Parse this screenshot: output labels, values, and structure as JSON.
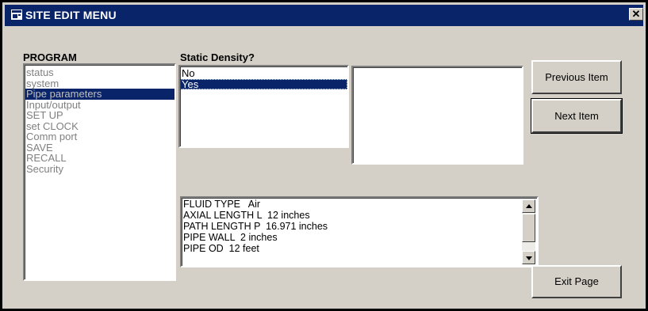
{
  "window": {
    "title": "SITE EDIT MENU",
    "close_label": "✕"
  },
  "program": {
    "label": "PROGRAM",
    "items": [
      {
        "label": "status",
        "selected": false
      },
      {
        "label": "system",
        "selected": false
      },
      {
        "label": "Pipe parameters",
        "selected": true
      },
      {
        "label": "Input/output",
        "selected": false
      },
      {
        "label": "SET UP",
        "selected": false
      },
      {
        "label": "set CLOCK",
        "selected": false
      },
      {
        "label": "Comm port",
        "selected": false
      },
      {
        "label": "SAVE",
        "selected": false
      },
      {
        "label": "RECALL",
        "selected": false
      },
      {
        "label": "Security",
        "selected": false
      }
    ]
  },
  "density": {
    "label": "Static Density?",
    "items": [
      {
        "label": "No",
        "selected": false
      },
      {
        "label": "Yes",
        "selected": true
      }
    ]
  },
  "info": {
    "lines": [
      "FLUID TYPE   Air",
      "AXIAL LENGTH L  12 inches",
      "PATH LENGTH P  16.971 inches",
      "PIPE WALL  2 inches",
      "PIPE OD  12 feet"
    ]
  },
  "buttons": {
    "previous": "Previous Item",
    "next": "Next Item",
    "exit": "Exit Page"
  },
  "colors": {
    "titlebar": "#0a246a",
    "face": "#d4d0c8",
    "selection": "#0a246a"
  }
}
